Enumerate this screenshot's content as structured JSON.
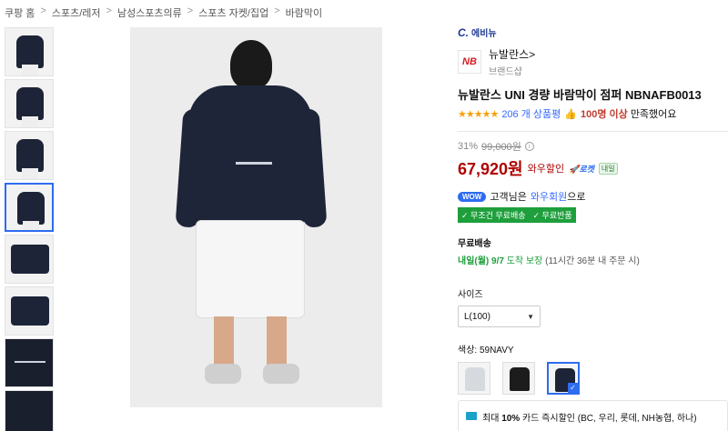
{
  "breadcrumb": [
    "쿠팡 홈",
    "스포츠/레저",
    "남성스포츠의류",
    "스포츠 자켓/집업",
    "바람막이"
  ],
  "breadcrumb_sep": ">",
  "store_badge": {
    "letter": "C.",
    "text": "에비뉴"
  },
  "brand": {
    "logo_text": "NB",
    "name": "뉴발란스",
    "arrow": ">",
    "shop": "브랜드샵"
  },
  "product_title": "뉴발란스 UNI 경량 바람막이 점퍼 NBNAFB0013",
  "rating": {
    "stars": "★★★★★",
    "review_count": "206 개 상품평",
    "thumb": "👍",
    "satisfied_count": "100명 이상",
    "satisfied_text": "만족했어요"
  },
  "price": {
    "discount_rate": "31%",
    "original": "99,000원",
    "info": "i",
    "final": "67,920원",
    "wow_label": "와우할인",
    "rocket": "🚀로켓",
    "tomorrow": "내일"
  },
  "wow": {
    "badge": "WOW",
    "text_prefix": "고객님은",
    "member": "와우회원",
    "text_suffix": "으로",
    "perks": [
      "✓ 무조건 무료배송",
      "✓ 무료반품"
    ]
  },
  "shipping": {
    "title": "무료배송",
    "arrival": "내일(월) 9/7",
    "arrival_suffix": "도착 보장",
    "note": "(11시간 36분 내 주문 시)"
  },
  "size": {
    "label": "사이즈",
    "selected": "L(100)",
    "caret": "▼"
  },
  "color": {
    "label": "색상: 59NAVY",
    "check": "✓"
  },
  "card_offer": {
    "prefix": "최대",
    "percent": "10%",
    "text": "카드 즉시할인 (BC, 우리, 롯데, NH농협, 하나)"
  }
}
